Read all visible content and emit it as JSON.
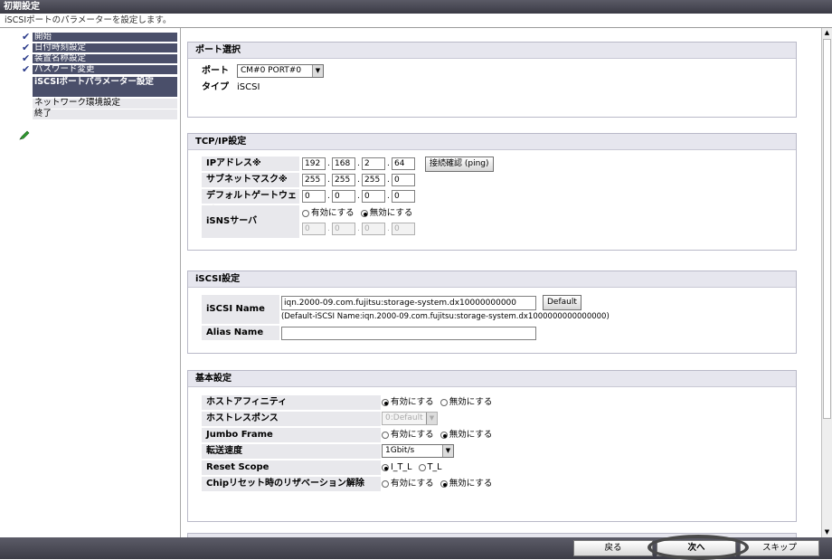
{
  "window": {
    "title": "初期設定",
    "subtitle": "iSCSIポートのパラメーターを設定します。"
  },
  "steps": [
    {
      "label": "開始",
      "status": "done"
    },
    {
      "label": "日付時刻設定",
      "status": "done"
    },
    {
      "label": "装置名称設定",
      "status": "done"
    },
    {
      "label": "パスワード変更",
      "status": "done"
    },
    {
      "label": "iSCSIポートパラメーター設定",
      "status": "current"
    },
    {
      "label": "ネットワーク環境設定",
      "status": "todo"
    },
    {
      "label": "終了",
      "status": "todo"
    }
  ],
  "port_select": {
    "title": "ポート選択",
    "port_label": "ポート",
    "port_value": "CM#0 PORT#0",
    "type_label": "タイプ",
    "type_value": "iSCSI"
  },
  "tcpip": {
    "title": "TCP/IP設定",
    "ip_label": "IPアドレス※",
    "ip": [
      "192",
      "168",
      "2",
      "64"
    ],
    "ping_button": "接続確認 (ping)",
    "mask_label": "サブネットマスク※",
    "mask": [
      "255",
      "255",
      "255",
      "0"
    ],
    "gateway_label": "デフォルトゲートウェイ",
    "gateway": [
      "0",
      "0",
      "0",
      "0"
    ],
    "isns_label": "iSNSサーバ",
    "isns_enable": "有効にする",
    "isns_disable": "無効にする",
    "isns_selected": "disable",
    "isns_ip": [
      "0",
      "0",
      "0",
      "0"
    ]
  },
  "iscsi": {
    "title": "iSCSI設定",
    "name_label": "iSCSI Name",
    "name_value": "iqn.2000-09.com.fujitsu:storage-system.dx10000000000",
    "default_button": "Default",
    "default_hint": "(Default-iSCSI Name:iqn.2000-09.com.fujitsu:storage-system.dx1000000000000000)",
    "alias_label": "Alias Name",
    "alias_value": ""
  },
  "basic": {
    "title": "基本設定",
    "host_affinity_label": "ホストアフィニティ",
    "host_affinity_on": "有効にする",
    "host_affinity_off": "無効にする",
    "host_affinity_selected": "on",
    "host_response_label": "ホストレスポンス",
    "host_response_value": "0:Default",
    "jumbo_label": "Jumbo Frame",
    "jumbo_on": "有効にする",
    "jumbo_off": "無効にする",
    "jumbo_selected": "off",
    "speed_label": "転送速度",
    "speed_value": "1Gbit/s",
    "reset_label": "Reset Scope",
    "reset_opt1": "I_T_L",
    "reset_opt2": "T_L",
    "reset_selected": "I_T_L",
    "chip_label": "Chipリセット時のリザベーション解除",
    "chip_on": "有効にする",
    "chip_off": "無効にする",
    "chip_selected": "off"
  },
  "footer": {
    "back": "戻る",
    "next": "次へ",
    "skip": "スキップ"
  }
}
